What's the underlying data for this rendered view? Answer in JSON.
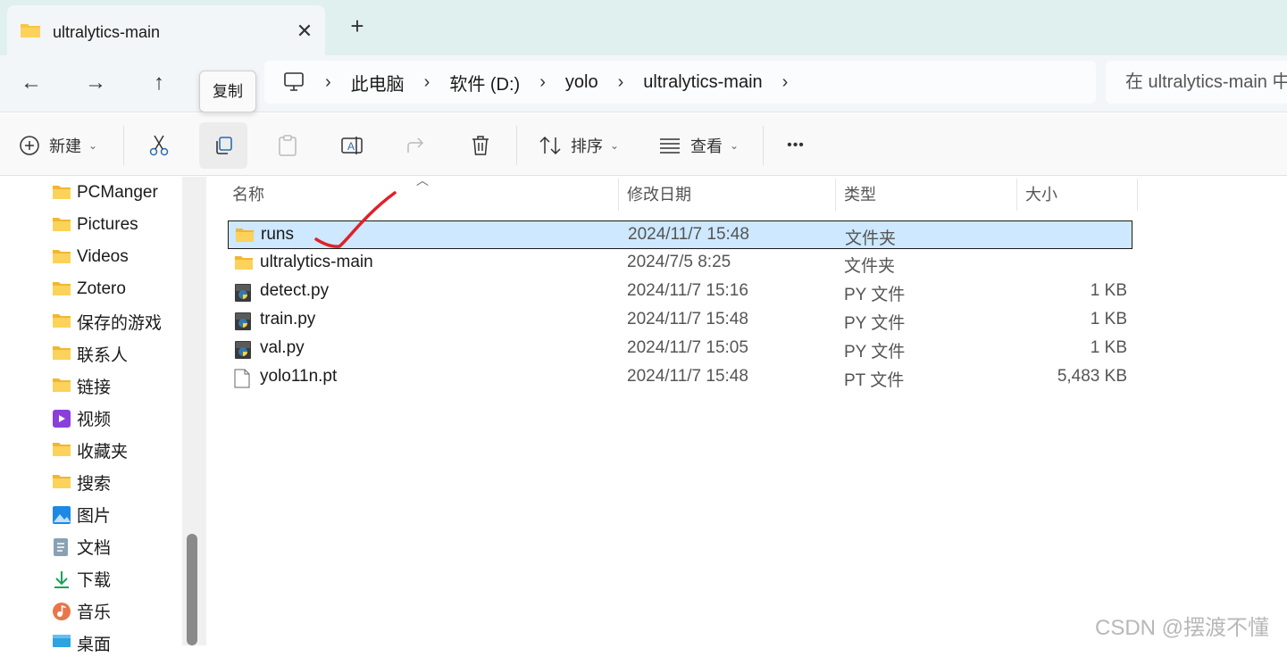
{
  "tab": {
    "title": "ultralytics-main",
    "close": "✕",
    "new": "+"
  },
  "nav": {
    "back": "←",
    "forward": "→",
    "up": "↑",
    "tooltip": "复制"
  },
  "breadcrumb": {
    "items": [
      "此电脑",
      "软件 (D:)",
      "yolo",
      "ultralytics-main"
    ],
    "sep": "›"
  },
  "search": {
    "placeholder": "在 ultralytics-main 中搜索"
  },
  "toolbar": {
    "new_label": "新建",
    "sort_label": "排序",
    "view_label": "查看",
    "more": "•••"
  },
  "sidebar": {
    "items": [
      {
        "label": "PCManger",
        "icon": "folder-icon"
      },
      {
        "label": "Pictures",
        "icon": "folder-icon"
      },
      {
        "label": "Videos",
        "icon": "folder-icon"
      },
      {
        "label": "Zotero",
        "icon": "folder-icon"
      },
      {
        "label": "保存的游戏",
        "icon": "folder-icon"
      },
      {
        "label": "联系人",
        "icon": "folder-icon"
      },
      {
        "label": "链接",
        "icon": "folder-icon"
      },
      {
        "label": "视频",
        "icon": "video-icon"
      },
      {
        "label": "收藏夹",
        "icon": "folder-icon"
      },
      {
        "label": "搜索",
        "icon": "folder-icon"
      },
      {
        "label": "图片",
        "icon": "image-icon"
      },
      {
        "label": "文档",
        "icon": "document-icon"
      },
      {
        "label": "下载",
        "icon": "download-icon"
      },
      {
        "label": "音乐",
        "icon": "music-icon"
      },
      {
        "label": "桌面",
        "icon": "desktop-icon"
      }
    ]
  },
  "table": {
    "columns": [
      "名称",
      "修改日期",
      "类型",
      "大小"
    ],
    "rows": [
      {
        "name": "runs",
        "date": "2024/11/7 15:48",
        "type": "文件夹",
        "size": "",
        "icon": "folder-icon"
      },
      {
        "name": "ultralytics-main",
        "date": "2024/7/5 8:25",
        "type": "文件夹",
        "size": "",
        "icon": "folder-icon"
      },
      {
        "name": "detect.py",
        "date": "2024/11/7 15:16",
        "type": "PY 文件",
        "size": "1 KB",
        "icon": "python-file-icon"
      },
      {
        "name": "train.py",
        "date": "2024/11/7 15:48",
        "type": "PY 文件",
        "size": "1 KB",
        "icon": "python-file-icon"
      },
      {
        "name": "val.py",
        "date": "2024/11/7 15:05",
        "type": "PY 文件",
        "size": "1 KB",
        "icon": "python-file-icon"
      },
      {
        "name": "yolo11n.pt",
        "date": "2024/11/7 15:48",
        "type": "PT 文件",
        "size": "5,483 KB",
        "icon": "file-icon"
      }
    ]
  },
  "watermark": "CSDN @摆渡不懂",
  "colors": {
    "accent": "#0067c0",
    "selected_row": "#cde8ff",
    "folder": "#f8c543",
    "annotation": "#e0202a"
  }
}
